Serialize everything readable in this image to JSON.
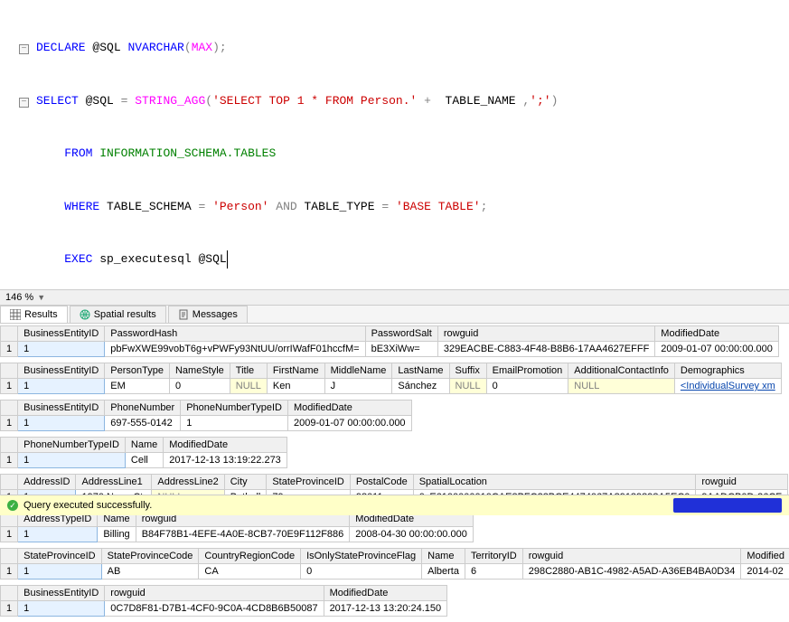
{
  "editor": {
    "prefix_spaces": "    ",
    "l1": {
      "kw1": "DECLARE",
      "at": "@SQL",
      "type": "NVARCHAR",
      "p1": "(",
      "max": "MAX",
      "p2": ");"
    },
    "l2": {
      "kw1": "SELECT",
      "at": "@SQL",
      "eq": " = ",
      "fn": "STRING_AGG",
      "p1": "(",
      "s1": "'SELECT TOP 1 * FROM Person.'",
      "plus": " + ",
      "col": " TABLE_NAME ",
      "comma": ",",
      "s2": "';'",
      "p2": ")"
    },
    "l3": {
      "kw1": "FROM",
      "tbl": "INFORMATION_SCHEMA.TABLES"
    },
    "l4": {
      "kw1": "WHERE",
      "c1": " TABLE_SCHEMA ",
      "eq": "= ",
      "s1": "'Person'",
      "and": " AND ",
      "c2": "TABLE_TYPE ",
      "eq2": "= ",
      "s2": "'BASE TABLE'",
      "semi": ";"
    },
    "l5": {
      "kw1": "EXEC",
      "sp": "sp_executesql ",
      "at": "@SQL"
    }
  },
  "zoom": "146 %",
  "tabs": {
    "results": "Results",
    "spatial": "Spatial results",
    "messages": "Messages"
  },
  "g1": {
    "h": [
      "",
      "BusinessEntityID",
      "PasswordHash",
      "PasswordSalt",
      "rowguid",
      "ModifiedDate"
    ],
    "r": [
      "1",
      "1",
      "pbFwXWE99vobT6g+vPWFy93NtUU/orrIWafF01hccfM=",
      "bE3XiWw=",
      "329EACBE-C883-4F48-B8B6-17AA4627EFFF",
      "2009-01-07 00:00:00.000"
    ]
  },
  "g2": {
    "h": [
      "",
      "BusinessEntityID",
      "PersonType",
      "NameStyle",
      "Title",
      "FirstName",
      "MiddleName",
      "LastName",
      "Suffix",
      "EmailPromotion",
      "AdditionalContactInfo",
      "Demographics"
    ],
    "r": [
      "1",
      "1",
      "EM",
      "0",
      "NULL",
      "Ken",
      "J",
      "Sánchez",
      "NULL",
      "0",
      "NULL",
      "<IndividualSurvey xm"
    ]
  },
  "g3": {
    "h": [
      "",
      "BusinessEntityID",
      "PhoneNumber",
      "PhoneNumberTypeID",
      "ModifiedDate"
    ],
    "r": [
      "1",
      "1",
      "697-555-0142",
      "1",
      "2009-01-07 00:00:00.000"
    ]
  },
  "g4": {
    "h": [
      "",
      "PhoneNumberTypeID",
      "Name",
      "ModifiedDate"
    ],
    "r": [
      "1",
      "1",
      "Cell",
      "2017-12-13 13:19:22.273"
    ]
  },
  "g5": {
    "h": [
      "",
      "AddressID",
      "AddressLine1",
      "AddressLine2",
      "City",
      "StateProvinceID",
      "PostalCode",
      "SpatialLocation",
      "rowguid"
    ],
    "r": [
      "1",
      "1",
      "1970 Napa Ct.",
      "NULL",
      "Bothell",
      "79",
      "98011",
      "0xE6100000010CAE8BFC28BCE4474067A89189898A5EC0",
      "9AADCB0D-36CF"
    ]
  },
  "g6": {
    "h": [
      "",
      "AddressTypeID",
      "Name",
      "rowguid",
      "ModifiedDate"
    ],
    "r": [
      "1",
      "1",
      "Billing",
      "B84F78B1-4EFE-4A0E-8CB7-70E9F112F886",
      "2008-04-30 00:00:00.000"
    ]
  },
  "g7": {
    "h": [
      "",
      "StateProvinceID",
      "StateProvinceCode",
      "CountryRegionCode",
      "IsOnlyStateProvinceFlag",
      "Name",
      "TerritoryID",
      "rowguid",
      "Modified"
    ],
    "r": [
      "1",
      "1",
      "AB",
      "CA",
      "0",
      "Alberta",
      "6",
      "298C2880-AB1C-4982-A5AD-A36EB4BA0D34",
      "2014-02"
    ]
  },
  "g8": {
    "h": [
      "",
      "BusinessEntityID",
      "rowguid",
      "ModifiedDate"
    ],
    "r": [
      "1",
      "1",
      "0C7D8F81-D7B1-4CF0-9C0A-4CD8B6B50087",
      "2017-12-13 13:20:24.150"
    ]
  },
  "status": "Query executed successfully."
}
